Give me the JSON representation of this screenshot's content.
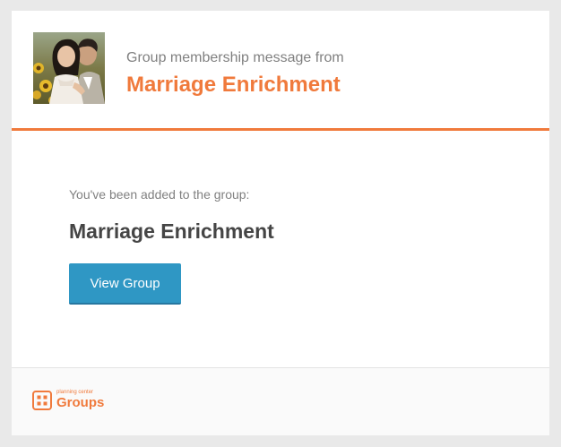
{
  "header": {
    "subtitle": "Group membership message from",
    "group_name": "Marriage Enrichment"
  },
  "body": {
    "added_text": "You've been added to the group:",
    "group_name": "Marriage Enrichment",
    "button_label": "View Group"
  },
  "footer": {
    "logo_small": "planning center",
    "logo_big": "Groups"
  },
  "colors": {
    "accent": "#f07a3c",
    "button": "#2f97c4",
    "heading": "#454545",
    "muted": "#808080",
    "background": "#e9e9e9"
  },
  "icons": {
    "group_photo": "group-photo",
    "logo": "planning-center-groups-logo-icon"
  }
}
